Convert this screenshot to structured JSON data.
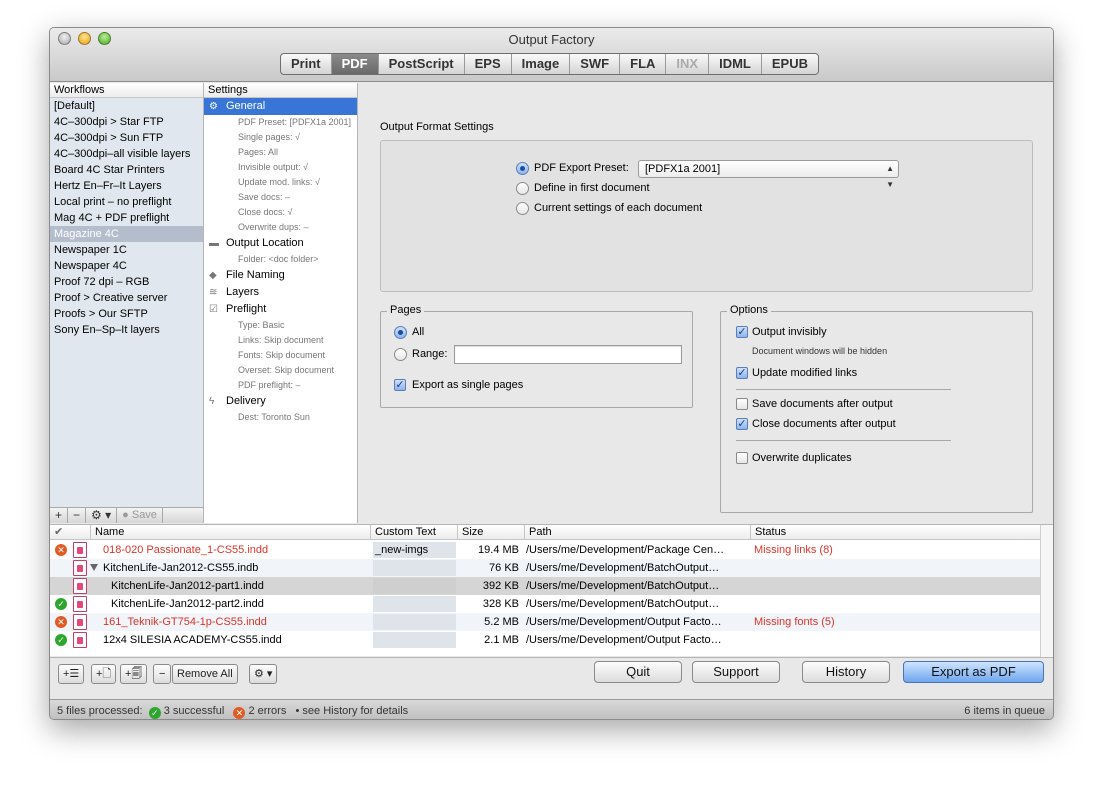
{
  "window": {
    "title": "Output Factory"
  },
  "colors": {
    "accent": "#3875d7",
    "error": "#d8352a",
    "success": "#2da62d",
    "selected_workflow": "#b4bdcc"
  },
  "tabs": [
    {
      "label": "Print",
      "active": false
    },
    {
      "label": "PDF",
      "active": true
    },
    {
      "label": "PostScript",
      "active": false
    },
    {
      "label": "EPS",
      "active": false
    },
    {
      "label": "Image",
      "active": false
    },
    {
      "label": "SWF",
      "active": false
    },
    {
      "label": "FLA",
      "active": false
    },
    {
      "label": "INX",
      "active": false,
      "disabled": true
    },
    {
      "label": "IDML",
      "active": false
    },
    {
      "label": "EPUB",
      "active": false
    }
  ],
  "workflows": {
    "header": "Workflows",
    "items": [
      "[Default]",
      "4C–300dpi > Star FTP",
      "4C–300dpi > Sun FTP",
      "4C–300dpi–all visible layers",
      "Board 4C Star Printers",
      "Hertz En–Fr–It Layers",
      "Local print – no preflight",
      "Mag 4C + PDF preflight",
      "Magazine 4C",
      "Newspaper 1C",
      "Newspaper 4C",
      "Proof 72 dpi – RGB",
      "Proof > Creative server",
      "Proofs > Our SFTP",
      "Sony En–Sp–It layers"
    ],
    "selected_index": 8,
    "toolbar": {
      "add": "+",
      "remove": "−",
      "gear": "⚙ ▾",
      "save": "● Save"
    }
  },
  "settings": {
    "header": "Settings",
    "general": {
      "label": "General",
      "subs": [
        "PDF Preset: [PDFX1a 2001]",
        "Single pages: √",
        "Pages: All",
        "Invisible output: √",
        "Update mod. links: √",
        "Save docs: –",
        "Close docs: √",
        "Overwrite dups: –"
      ]
    },
    "output_location": {
      "label": "Output Location",
      "subs": [
        "Folder: <doc folder>"
      ]
    },
    "file_naming": {
      "label": "File Naming"
    },
    "layers": {
      "label": "Layers"
    },
    "preflight": {
      "label": "Preflight",
      "subs": [
        "Type: Basic",
        "Links: Skip document",
        "Fonts: Skip document",
        "Overset: Skip document",
        "PDF preflight: –"
      ]
    },
    "delivery": {
      "label": "Delivery",
      "subs": [
        "Dest: Toronto Sun"
      ]
    }
  },
  "output_format": {
    "title": "Output Format Settings",
    "opt_preset": "PDF Export Preset:",
    "preset_value": "[PDFX1a 2001]",
    "opt_first": "Define in first document",
    "opt_current": "Current settings of each document"
  },
  "pages": {
    "legend": "Pages",
    "all": "All",
    "range": "Range:",
    "range_value": "",
    "single": "Export as single pages"
  },
  "options": {
    "legend": "Options",
    "invisibly": "Output invisibly",
    "invisibly_note": "Document windows will be hidden",
    "update_links": "Update modified links",
    "save_docs": "Save documents after output",
    "close_docs": "Close documents after output",
    "overwrite": "Overwrite duplicates"
  },
  "files": {
    "columns": {
      "status_icon": "✔",
      "name": "Name",
      "custom_text": "Custom Text",
      "size": "Size",
      "path": "Path",
      "status": "Status"
    },
    "rows": [
      {
        "name": "018-020 Passionate_1-CS55.indd",
        "custom": "_new-imgs",
        "size": "19.4 MB",
        "path": "/Users/me/Development/Package Cen…",
        "status": "Missing links (8)"
      },
      {
        "name": "KitchenLife-Jan2012-CS55.indb",
        "custom": "",
        "size": "76 KB",
        "path": "/Users/me/Development/BatchOutput…",
        "status": ""
      },
      {
        "name": "KitchenLife-Jan2012-part1.indd",
        "custom": "",
        "size": "392 KB",
        "path": "/Users/me/Development/BatchOutput…",
        "status": ""
      },
      {
        "name": "KitchenLife-Jan2012-part2.indd",
        "custom": "",
        "size": "328 KB",
        "path": "/Users/me/Development/BatchOutput…",
        "status": ""
      },
      {
        "name": "161_Teknik-GT754-1p-CS55.indd",
        "custom": "",
        "size": "5.2 MB",
        "path": "/Users/me/Development/Output Facto…",
        "status": "Missing fonts (5)"
      },
      {
        "name": "12x4 SILESIA ACADEMY-CS55.indd",
        "custom": "",
        "size": "2.1 MB",
        "path": "/Users/me/Development/Output Facto…",
        "status": ""
      }
    ]
  },
  "bottom": {
    "add_list": "+☰",
    "add_file": "+🗋",
    "add_folder": "+🗐",
    "remove": "−",
    "remove_all": "Remove All",
    "gear": "⚙ ▾",
    "quit": "Quit",
    "support": "Support",
    "history": "History",
    "export": "Export as PDF"
  },
  "status": {
    "processed": "5 files processed:",
    "successful": "3 successful",
    "errors": "2 errors",
    "see_history": "•  see History for details",
    "queue": "6 items in queue"
  }
}
